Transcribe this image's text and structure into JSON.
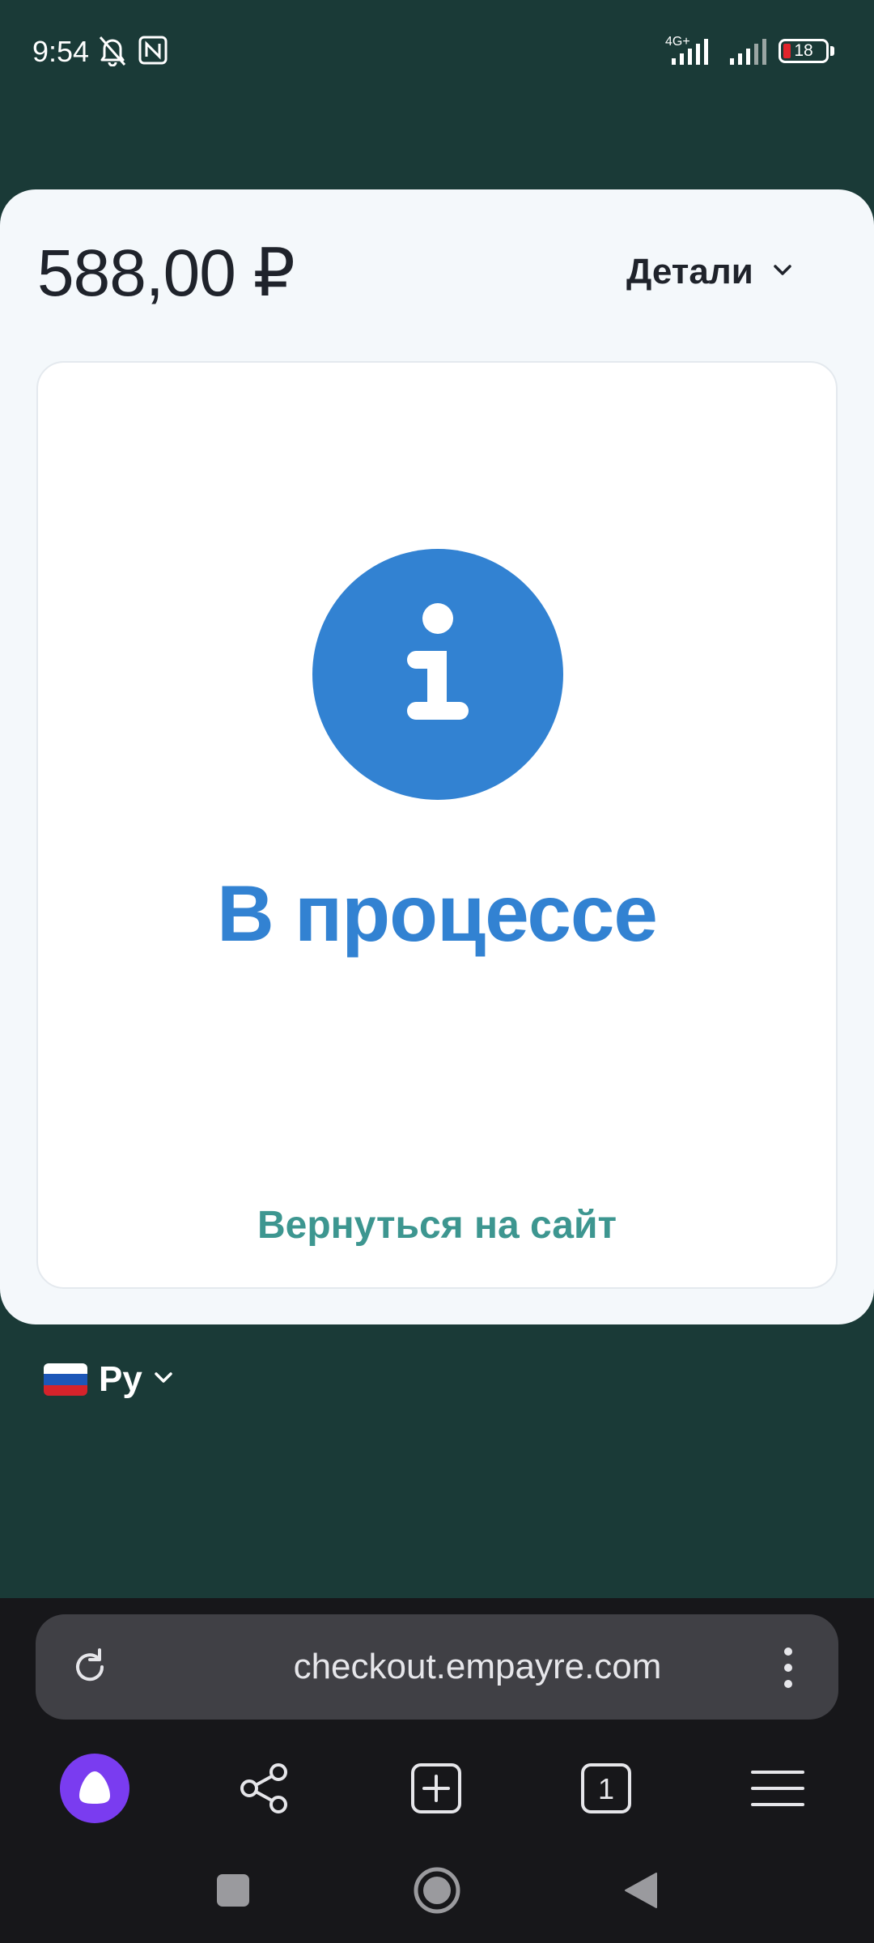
{
  "status_bar": {
    "time": "9:54",
    "network": "4G+",
    "battery_level": "18",
    "icons": [
      "bell-off-icon",
      "nfc-icon",
      "signal-icon",
      "signal-icon",
      "battery-icon"
    ]
  },
  "payment": {
    "amount": "588,00 ₽",
    "details_label": "Детали",
    "status_text": "В процессе",
    "return_link": "Вернуться на сайт"
  },
  "language": {
    "label": "Ру",
    "flag": "🇷🇺"
  },
  "browser": {
    "url": "checkout.empayre.com",
    "tab_count": "1"
  },
  "colors": {
    "background": "#1a3a37",
    "sheet": "#f4f8fb",
    "accent_blue": "#3282d2",
    "link_teal": "#3d9690",
    "browser_bar": "#17171a"
  }
}
